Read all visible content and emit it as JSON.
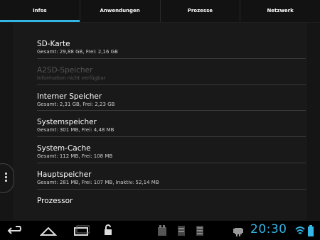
{
  "tabs": [
    {
      "label": "Infos",
      "active": true
    },
    {
      "label": "Anwendungen",
      "active": false
    },
    {
      "label": "Prozesse",
      "active": false
    },
    {
      "label": "Netzwerk",
      "active": false
    }
  ],
  "items": [
    {
      "title": "SD-Karte",
      "subtitle": "Gesamt: 29,88 GB, Frei: 2,16 GB",
      "disabled": false
    },
    {
      "title": "A2SD-Speicher",
      "subtitle": "Information nicht verfügbar",
      "disabled": true
    },
    {
      "title": "Interner Speicher",
      "subtitle": "Gesamt: 2,31 GB, Frei: 2,23 GB",
      "disabled": false
    },
    {
      "title": "Systemspeicher",
      "subtitle": "Gesamt: 301 MB, Frei: 4,48 MB",
      "disabled": false
    },
    {
      "title": "System-Cache",
      "subtitle": "Gesamt: 112 MB, Frei: 108 MB",
      "disabled": false
    },
    {
      "title": "Hauptspeicher",
      "subtitle": "Gesamt: 281 MB, Frei: 107 MB, Inaktiv: 52,14 MB",
      "disabled": false
    },
    {
      "title": "Prozessor",
      "subtitle": "",
      "disabled": false
    }
  ],
  "status": {
    "time": "20:30",
    "accent_color": "#33b5e5"
  },
  "icons": {
    "back": "back-icon",
    "home": "home-icon",
    "recents": "recent-apps-icon",
    "lock": "unlock-icon",
    "notification1": "notification-app-icon",
    "notification2": "notification-sd-icon",
    "notification3": "notification-storage-icon",
    "debug": "android-debug-icon",
    "wifi": "wifi-icon",
    "battery": "battery-icon"
  }
}
